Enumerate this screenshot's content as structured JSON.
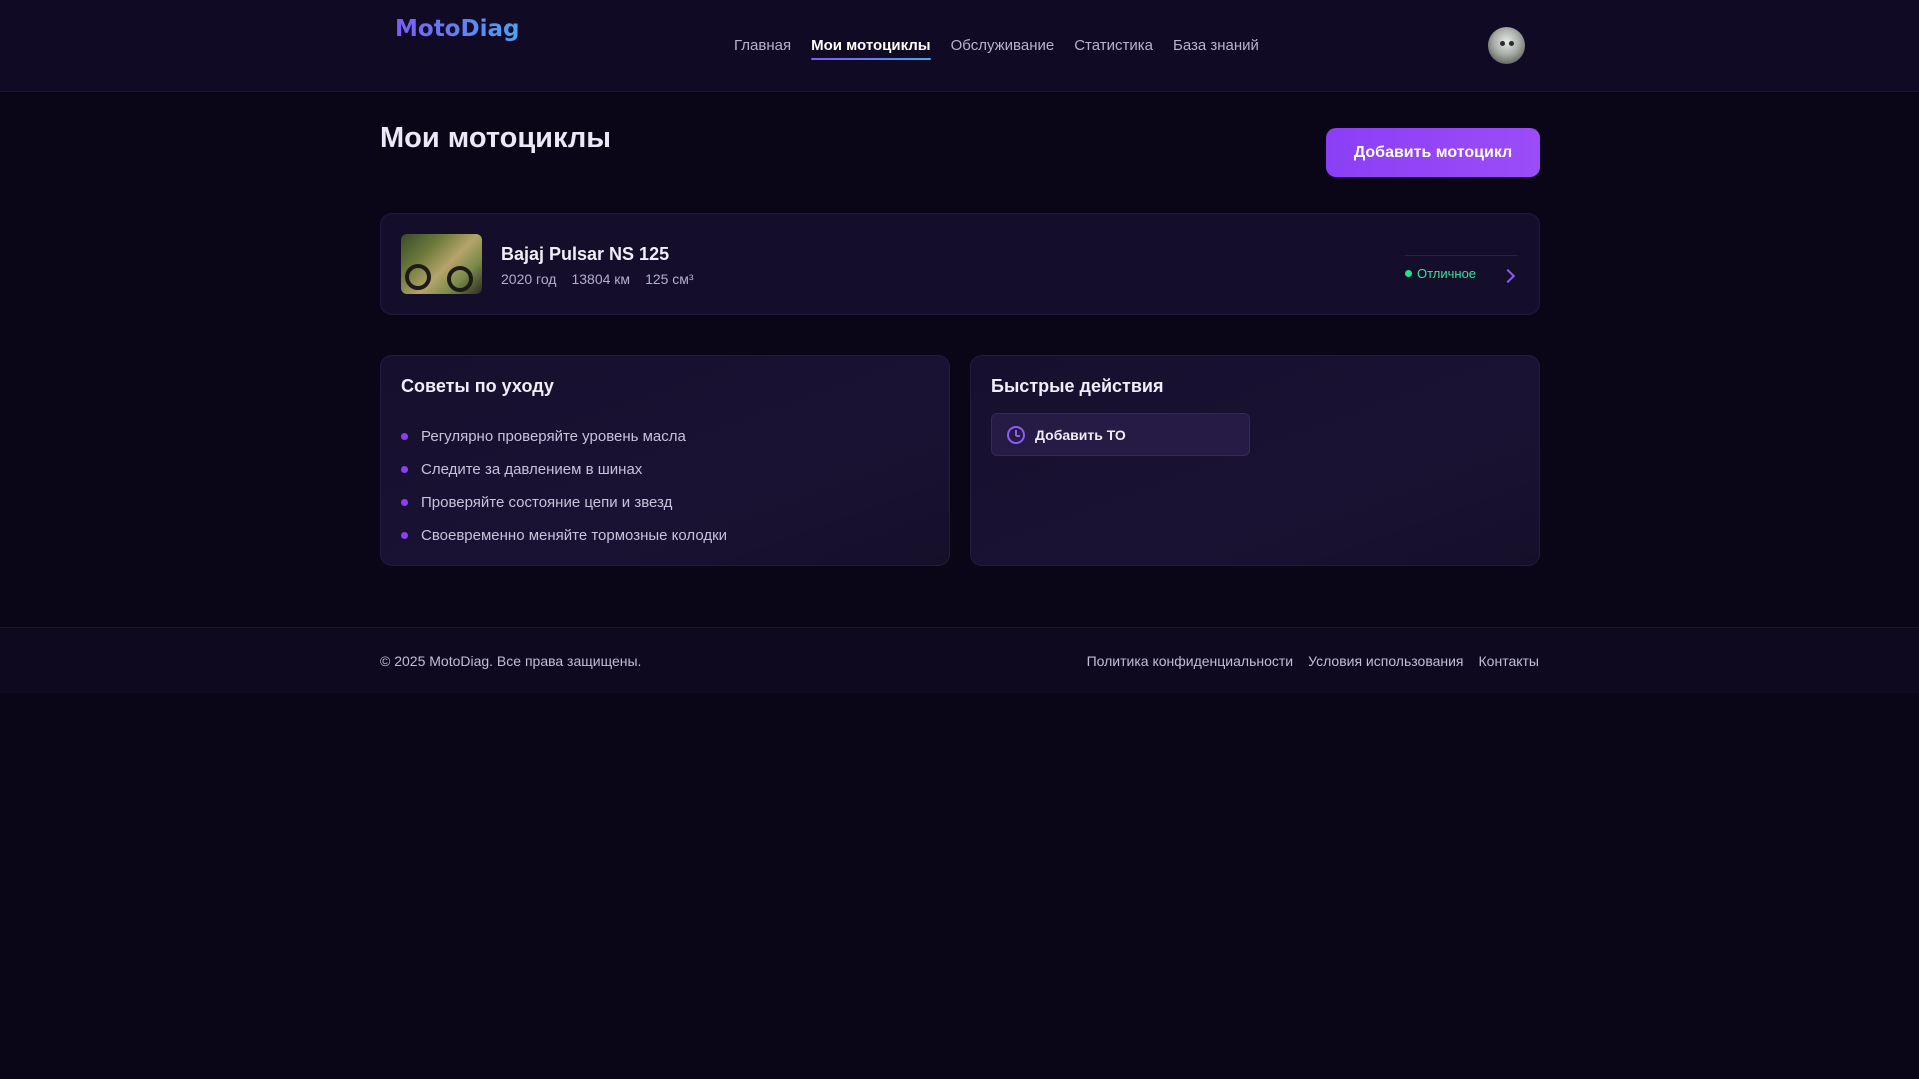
{
  "header": {
    "logo": "MotoDiag",
    "nav": [
      {
        "label": "Главная"
      },
      {
        "label": "Мои мотоциклы",
        "active": true
      },
      {
        "label": "Обслуживание"
      },
      {
        "label": "Статистика"
      },
      {
        "label": "База знаний"
      }
    ]
  },
  "main": {
    "title": "Мои мотоциклы",
    "add_button": "Добавить мотоцикл",
    "motorcycle": {
      "name": "Bajaj Pulsar NS 125",
      "year": "2020 год",
      "mileage": "13804 км",
      "engine": "125 см³",
      "status": "Отличное"
    }
  },
  "tips": {
    "title": "Советы по уходу",
    "items": [
      "Регулярно проверяйте уровень масла",
      "Следите за давлением в шинах",
      "Проверяйте состояние цепи и звезд",
      "Своевременно меняйте тормозные колодки"
    ]
  },
  "quick_actions": {
    "title": "Быстрые действия",
    "add_maintenance": "Добавить ТО"
  },
  "footer": {
    "copyright": "© 2025 MotoDiag. Все права защищены.",
    "links": [
      "Политика конфиденциальности",
      "Условия использования",
      "Контакты"
    ]
  },
  "colors": {
    "background": "#0a0618",
    "accent": "#8b3ff5",
    "status_ok": "#1ee38a"
  },
  "icons": {
    "status": "status-dot-icon",
    "open": "chevron-right-icon",
    "maintenance": "clock-icon"
  }
}
